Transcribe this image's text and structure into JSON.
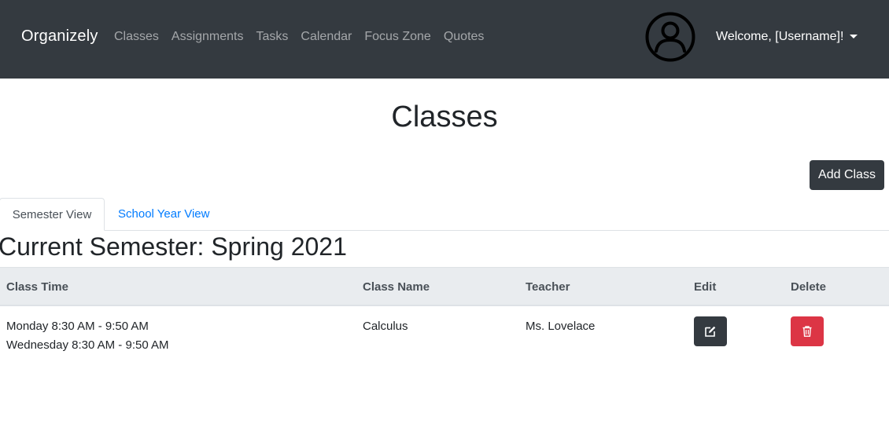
{
  "navbar": {
    "brand": "Organizely",
    "links": [
      "Classes",
      "Assignments",
      "Tasks",
      "Calendar",
      "Focus Zone",
      "Quotes"
    ],
    "user_greeting": "Welcome, [Username]!",
    "background": "#343a40"
  },
  "page": {
    "title": "Classes",
    "add_button": "Add Class"
  },
  "tabs": [
    {
      "label": "Semester View",
      "active": true
    },
    {
      "label": "School Year View",
      "active": false
    }
  ],
  "semester_heading": "Current Semester: Spring 2021",
  "table": {
    "headers": [
      "Class Time",
      "Class Name",
      "Teacher",
      "Edit",
      "Delete"
    ],
    "rows": [
      {
        "times": [
          "Monday 8:30 AM - 9:50 AM",
          "Wednesday 8:30 AM - 9:50 AM"
        ],
        "class_name": "Calculus",
        "teacher": "Ms. Lovelace",
        "edit_icon": "edit-icon",
        "delete_icon": "trash-icon"
      }
    ]
  },
  "colors": {
    "primary_link": "#007bff",
    "danger": "#dc3545",
    "dark": "#343a40",
    "table_header": "#e9ecef"
  }
}
